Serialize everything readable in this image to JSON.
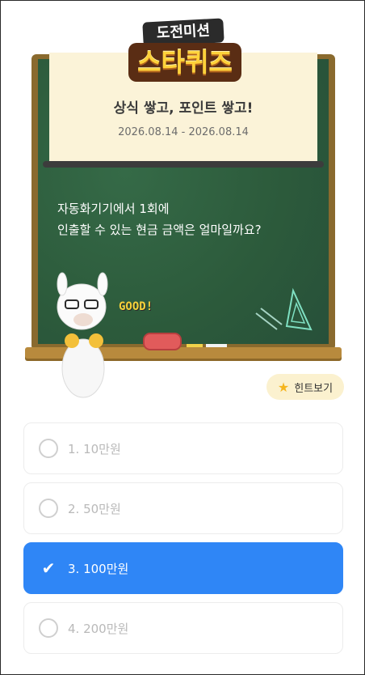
{
  "logo": {
    "top": "도전미션",
    "main": "스타퀴즈"
  },
  "board": {
    "title": "상식 쌓고, 포인트 쌓고!",
    "date": "2026.08.14 - 2026.08.14",
    "question_line1": "자동화기기에서 1회에",
    "question_line2": "인출할 수 있는 현금 금액은 얼마일까요?",
    "good": "GOOD!"
  },
  "hint": {
    "label": "힌트보기",
    "icon": "star-icon"
  },
  "options": [
    {
      "label": "1. 10만원",
      "selected": false
    },
    {
      "label": "2. 50만원",
      "selected": false
    },
    {
      "label": "3. 100만원",
      "selected": true
    },
    {
      "label": "4. 200만원",
      "selected": false
    }
  ],
  "colors": {
    "board": "#2e5e3e",
    "frame": "#8a6a2e",
    "accent": "#2f86f6",
    "hint_bg": "#fbf1cf"
  }
}
